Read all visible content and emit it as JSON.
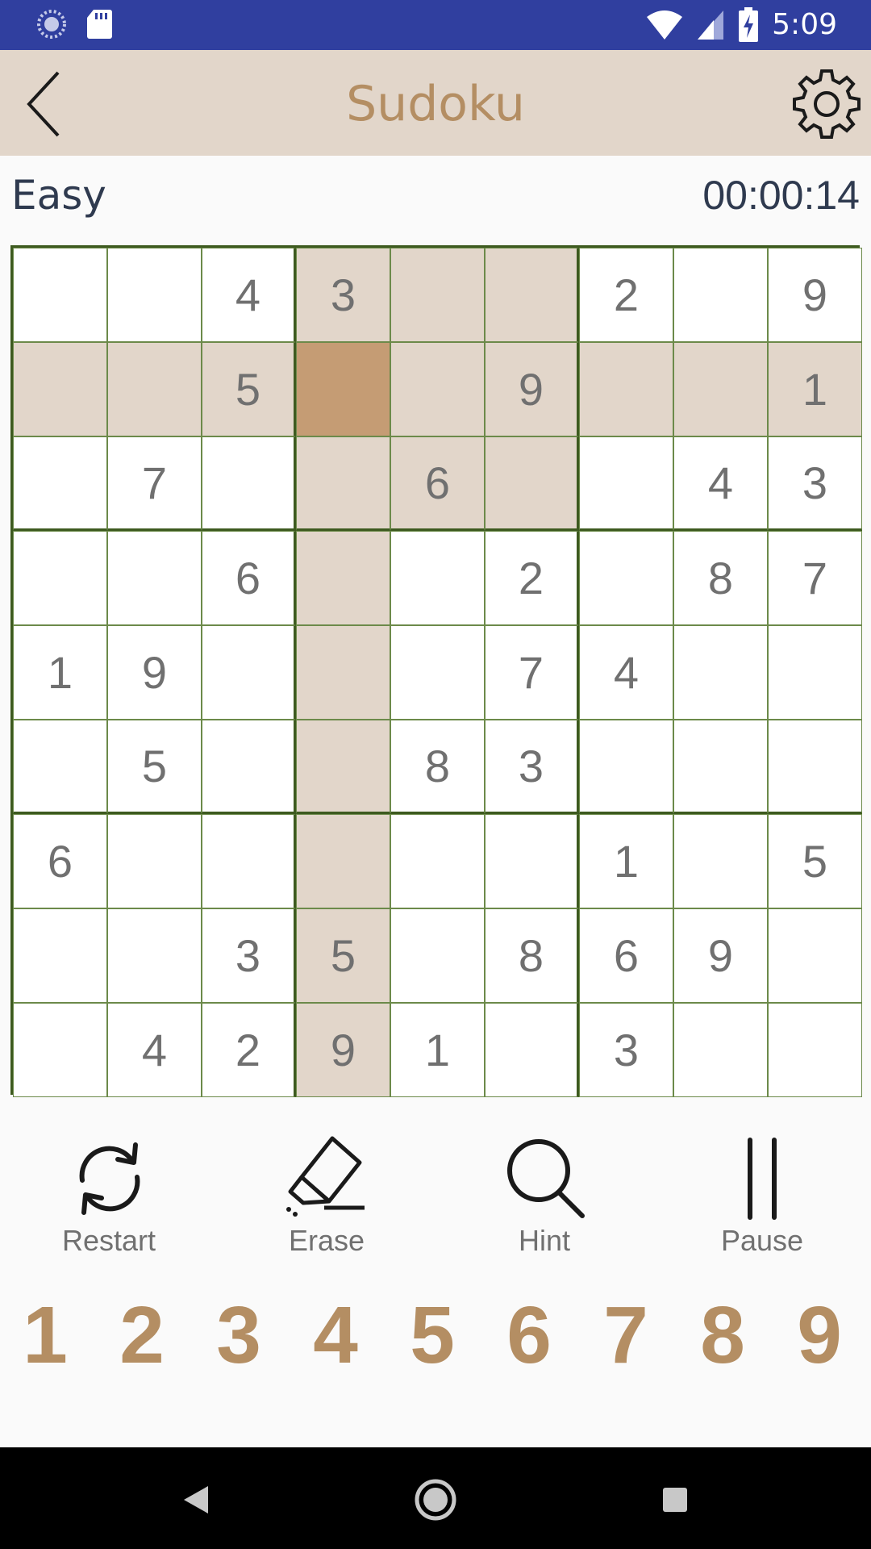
{
  "status_bar": {
    "time": "5:09",
    "icons": [
      "loading-icon",
      "sd-card-icon",
      "wifi-icon",
      "signal-icon",
      "battery-charging-icon"
    ]
  },
  "app_bar": {
    "title": "Sudoku",
    "back_icon": "chevron-left-icon",
    "settings_icon": "gear-icon"
  },
  "game": {
    "difficulty": "Easy",
    "timer": "00:00:14"
  },
  "board": {
    "rows": [
      [
        "",
        "",
        "4",
        "3",
        "",
        "",
        "2",
        "",
        "9"
      ],
      [
        "",
        "",
        "5",
        "",
        "",
        "9",
        "",
        "",
        "1"
      ],
      [
        "",
        "7",
        "",
        "",
        "6",
        "",
        "",
        "4",
        "3"
      ],
      [
        "",
        "",
        "6",
        "",
        "",
        "2",
        "",
        "8",
        "7"
      ],
      [
        "1",
        "9",
        "",
        "",
        "",
        "7",
        "4",
        "",
        ""
      ],
      [
        "",
        "5",
        "",
        "",
        "8",
        "3",
        "",
        "",
        ""
      ],
      [
        "6",
        "",
        "",
        "",
        "",
        "",
        "1",
        "",
        "5"
      ],
      [
        "",
        "",
        "3",
        "5",
        "",
        "8",
        "6",
        "9",
        ""
      ],
      [
        "",
        "4",
        "2",
        "9",
        "1",
        "",
        "3",
        "",
        ""
      ]
    ],
    "selected": {
      "row": 1,
      "col": 3
    },
    "colors": {
      "highlight": "#e2d6ca",
      "selected": "#c59c74",
      "grid": "#3d5a1f"
    }
  },
  "tools": [
    {
      "label": "Restart",
      "icon": "restart-icon"
    },
    {
      "label": "Erase",
      "icon": "eraser-icon"
    },
    {
      "label": "Hint",
      "icon": "search-icon"
    },
    {
      "label": "Pause",
      "icon": "pause-icon"
    }
  ],
  "numpad": [
    "1",
    "2",
    "3",
    "4",
    "5",
    "6",
    "7",
    "8",
    "9"
  ],
  "nav_bar": {
    "icons": [
      "back-triangle-icon",
      "home-circle-icon",
      "recents-square-icon"
    ]
  },
  "colors": {
    "status_bar": "#303f9f",
    "app_bar": "#e2d6ca",
    "accent": "#b48e63"
  }
}
